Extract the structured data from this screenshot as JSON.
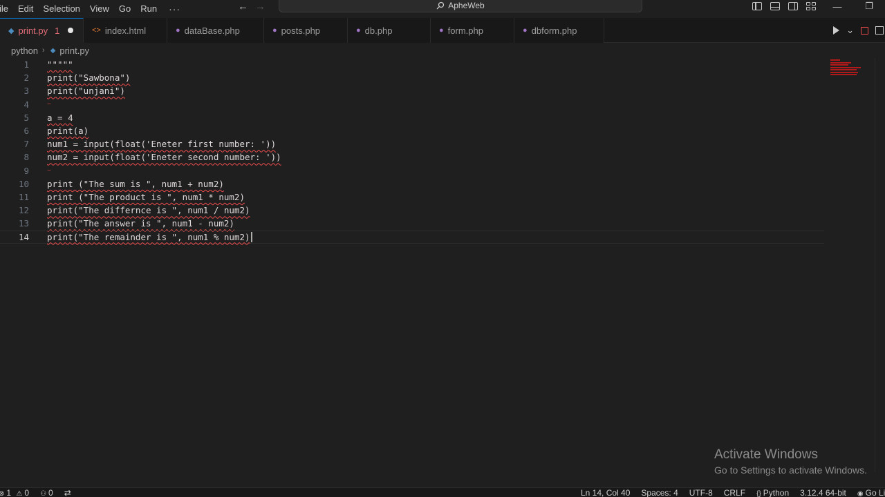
{
  "titlebar": {
    "menu": [
      "ile",
      "Edit",
      "Selection",
      "View",
      "Go",
      "Run"
    ],
    "more": "···",
    "search_text": "ApheWeb",
    "back_arrow": "←",
    "forward_arrow": "→",
    "minimize": "—",
    "restore": "❐"
  },
  "tabs": [
    {
      "label": "print.py",
      "icon": "python-icon",
      "problems": "1",
      "modified": true,
      "active": true
    },
    {
      "label": "index.html",
      "icon": "html-icon"
    },
    {
      "label": "dataBase.php",
      "icon": "php-icon"
    },
    {
      "label": "posts.php",
      "icon": "php-icon"
    },
    {
      "label": "db.php",
      "icon": "php-icon"
    },
    {
      "label": "form.php",
      "icon": "php-icon"
    },
    {
      "label": "dbform.php",
      "icon": "php-icon"
    }
  ],
  "breadcrumb": {
    "folder": "python",
    "file": "print.py"
  },
  "editor": {
    "lines": [
      {
        "num": "1",
        "code": "\"\"\"\"\""
      },
      {
        "num": "2",
        "code": "print(\"Sawbona\")"
      },
      {
        "num": "3",
        "code": "print(\"unjani\")"
      },
      {
        "num": "4",
        "code": ""
      },
      {
        "num": "5",
        "code": "a = 4"
      },
      {
        "num": "6",
        "code": "print(a)"
      },
      {
        "num": "7",
        "code": "num1 = input(float('Eneter first number: '))"
      },
      {
        "num": "8",
        "code": "num2 = input(float('Eneter second number: '))"
      },
      {
        "num": "9",
        "code": ""
      },
      {
        "num": "10",
        "code": "print (\"The sum is \", num1 + num2)"
      },
      {
        "num": "11",
        "code": "print (\"The product is \", num1 * num2)"
      },
      {
        "num": "12",
        "code": "print(\"The differnce is \", num1 / num2)"
      },
      {
        "num": "13",
        "code": "print(\"The answer is \", num1 - num2)"
      },
      {
        "num": "14",
        "code": "print(\"The remainder is \", num1 % num2)"
      }
    ],
    "current_line": "14"
  },
  "watermark": {
    "title": "Activate Windows",
    "subtitle": "Go to Settings to activate Windows."
  },
  "statusbar": {
    "errors": "1",
    "warnings": "0",
    "ports": "0",
    "position": "Ln 14, Col 40",
    "spaces": "Spaces: 4",
    "encoding": "UTF-8",
    "eol": "CRLF",
    "language": "Python",
    "interpreter": "3.12.4 64-bit",
    "golive": "Go Liv"
  },
  "colors": {
    "accent": "#0078d4",
    "error": "#f14c4c",
    "modified_tab": "#e06c75"
  }
}
